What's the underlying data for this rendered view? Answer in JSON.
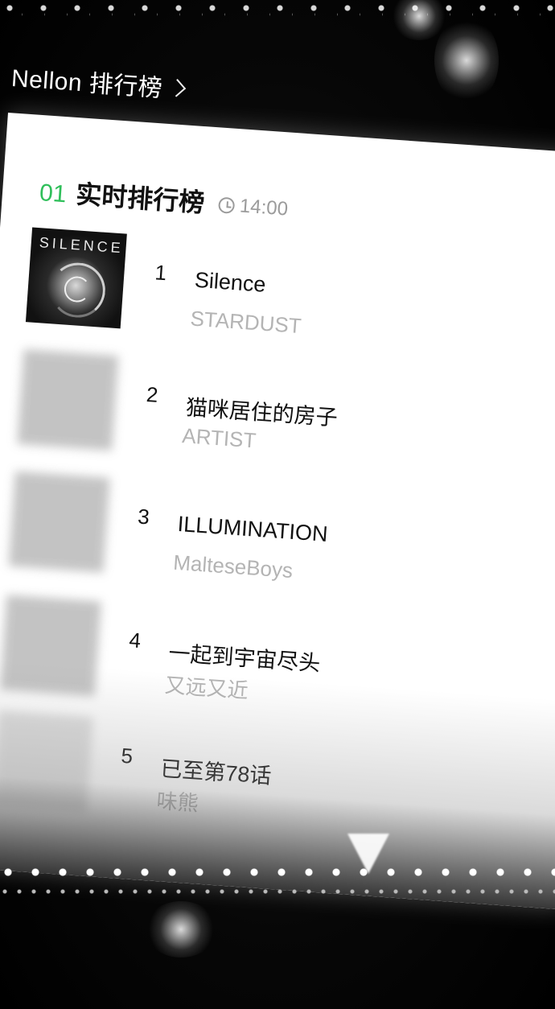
{
  "header": {
    "title": "Nellon 排行榜"
  },
  "chart": {
    "number": "01",
    "title": "实时排行榜",
    "time": "14:00"
  },
  "items": [
    {
      "rank": "1",
      "song": "Silence",
      "artist": "STARDUST",
      "cover_text": "SILENCE"
    },
    {
      "rank": "2",
      "song": "猫咪居住的房子",
      "artist": "ARTIST"
    },
    {
      "rank": "3",
      "song": "ILLUMINATION",
      "artist": "MalteseBoys"
    },
    {
      "rank": "4",
      "song": "一起到宇宙尽头",
      "artist": "又远又近"
    },
    {
      "rank": "5",
      "song": "已至第78话",
      "artist": "味熊"
    }
  ],
  "colors": {
    "accent": "#2fbf5a",
    "background": "#050505",
    "card": "#ffffff",
    "secondary_text": "#b4b4b4"
  }
}
